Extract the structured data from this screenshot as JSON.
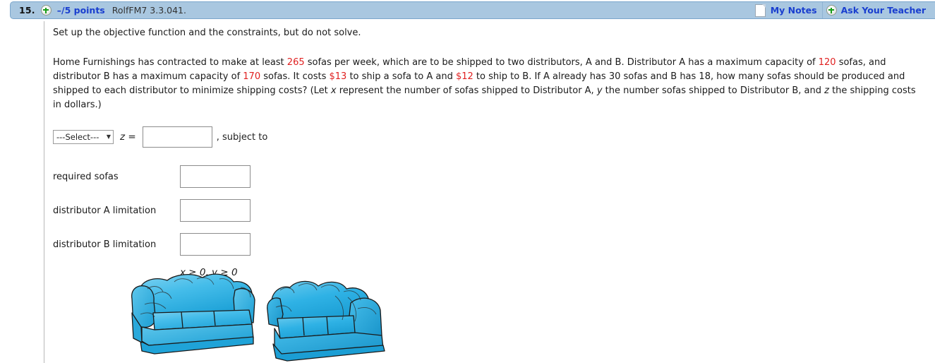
{
  "header": {
    "question_number": "15.",
    "expand_icon": "plus-circle-icon",
    "points": "–/5 points",
    "question_code": "RolfFM7 3.3.041.",
    "my_notes_label": "My Notes",
    "my_notes_icon": "note-page-icon",
    "ask_teacher_label": "Ask Your Teacher",
    "ask_teacher_icon": "plus-circle-icon",
    "bar_color": "#a9c7e0",
    "link_color": "#1a3fcf",
    "plus_color": "#179c18"
  },
  "body": {
    "instruction": "Set up the objective function and the constraints, but do not solve.",
    "problem": {
      "p1": "Home Furnishings has contracted to make at least ",
      "v_required": "265",
      "p2": " sofas per week, which are to be shipped to two distributors, A and B. Distributor A has a maximum capacity of ",
      "v_capA": "120",
      "p3": " sofas, and distributor B has a maximum capacity of ",
      "v_capB": "170",
      "p4": " sofas. It costs ",
      "v_costA": "$13",
      "p5": " to ship a sofa to A and ",
      "v_costB": "$12",
      "p6": " to ship to B. If A already has 30 sofas and B has 18, how many sofas should be produced and shipped to each distributor to minimize shipping costs? (Let ",
      "var_x": "x",
      "p7": " represent the number of sofas shipped to Distributor A, ",
      "var_y": "y",
      "p8": " the number sofas shipped to Distributor B, and ",
      "var_z": "z",
      "p9": " the shipping costs in dollars.)",
      "red_color": "#e02020"
    }
  },
  "answer": {
    "select_value": "---Select---",
    "select_caret": "chevron-down-icon",
    "z_equals_label": "z =",
    "objective_input_value": "",
    "objective_input_placeholder": "",
    "subject_to_label": ", subject to",
    "constraints": [
      {
        "label": "required sofas",
        "value": "",
        "name": "required-sofas"
      },
      {
        "label": "distributor A limitation",
        "value": "",
        "name": "distributor-a-limitation"
      },
      {
        "label": "distributor B limitation",
        "value": "",
        "name": "distributor-b-limitation"
      }
    ],
    "nonnegativity": "x ≥ 0, y ≥ 0"
  },
  "illustration": {
    "alt": "two blue sofas",
    "sofa_fill": "#35b6e8",
    "sofa_shade": "#1fa3d8",
    "sofa_highlight": "#7fd2f0",
    "outline": "#1a1a1a"
  }
}
